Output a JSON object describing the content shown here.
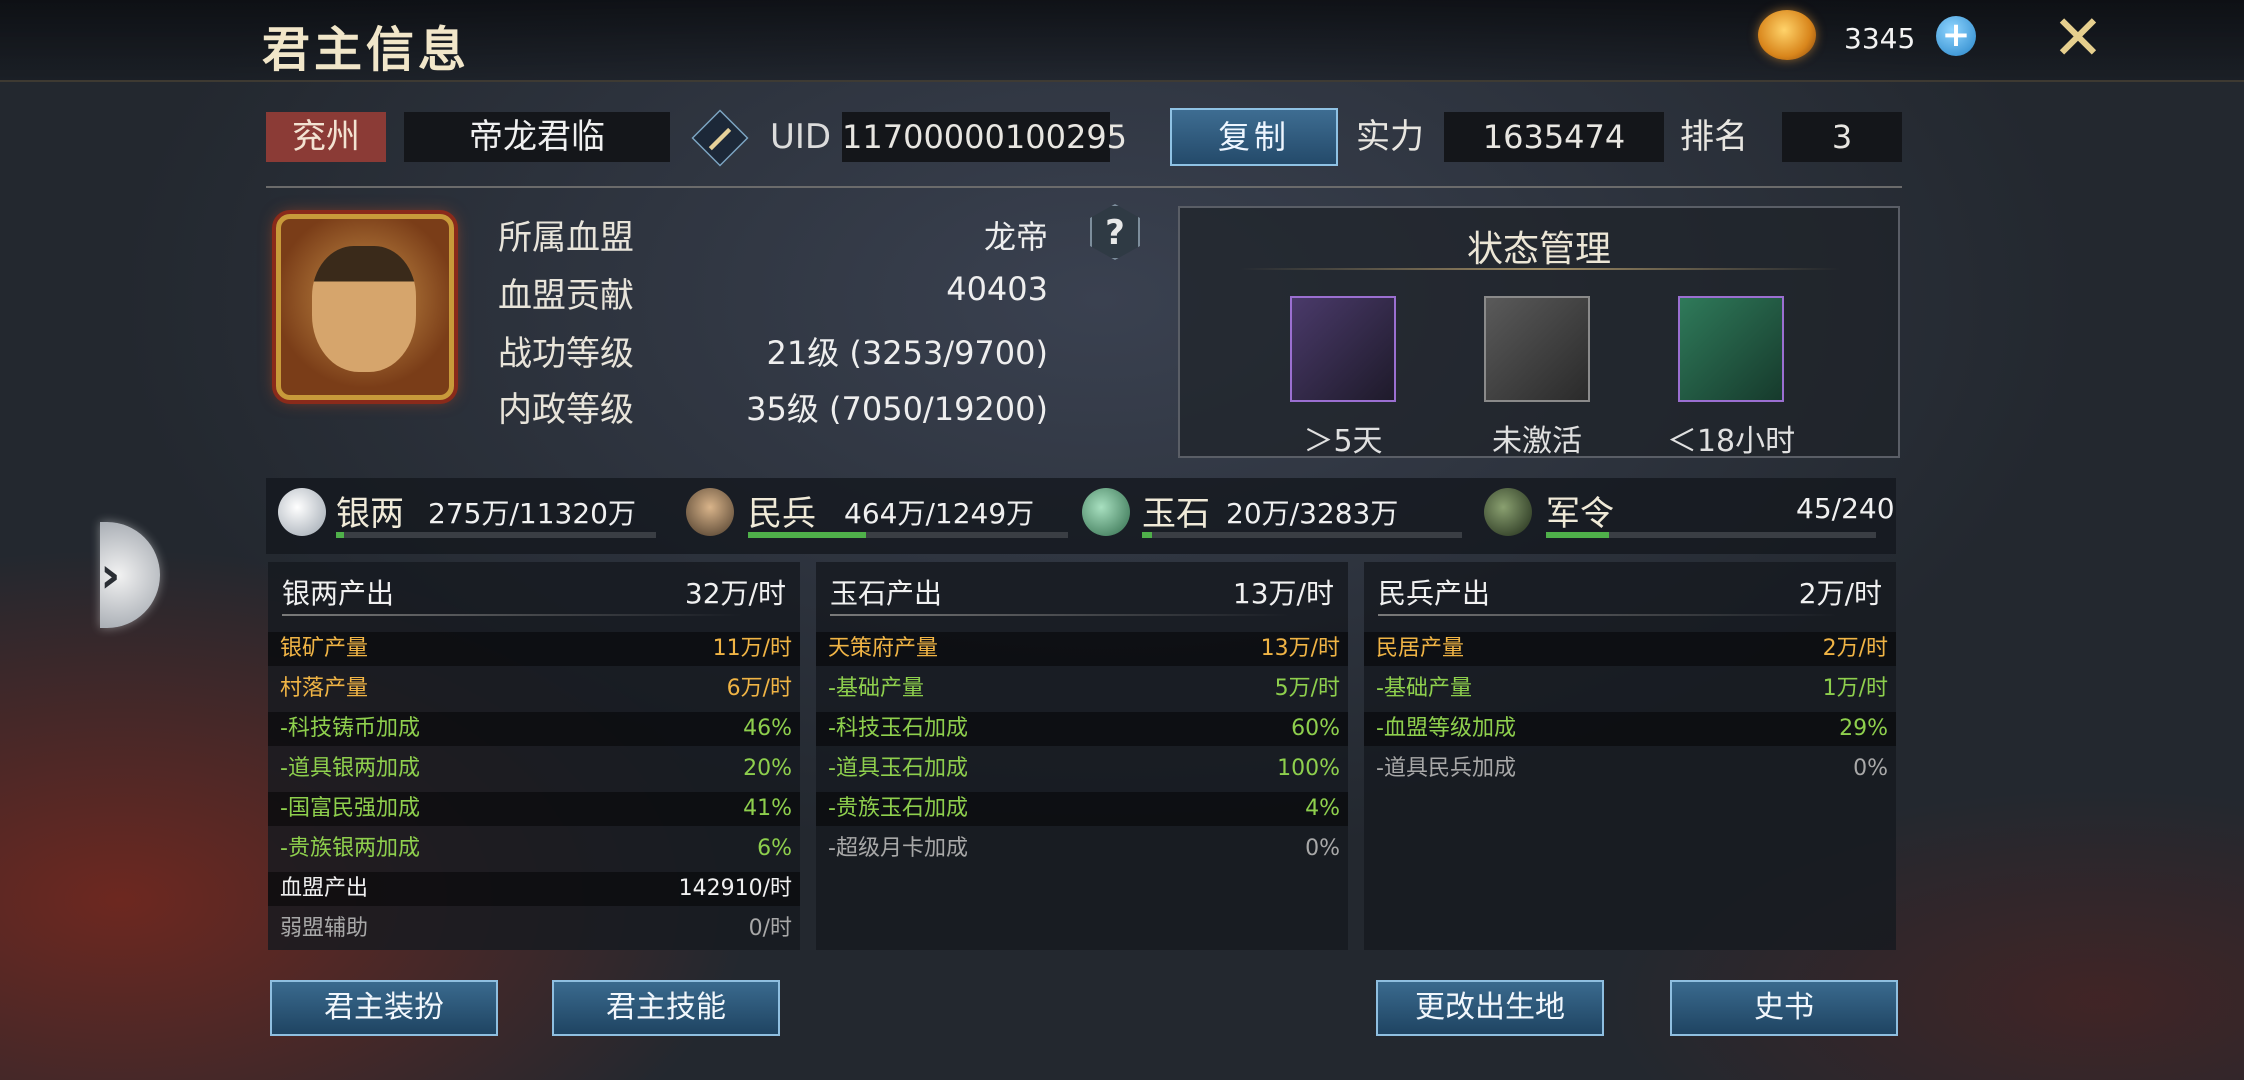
{
  "header": {
    "title": "君主信息",
    "gold": "3345",
    "plus": "+",
    "close": "✕"
  },
  "profile": {
    "province": "兖州",
    "name": "帝龙君临",
    "uid_label": "UID",
    "uid": "11700000100295",
    "copy_label": "复制",
    "power_label": "实力",
    "power": "1635474",
    "rank_label": "排名",
    "rank": "3"
  },
  "details": [
    {
      "label": "所属血盟",
      "value": "龙帝"
    },
    {
      "label": "血盟贡献",
      "value": "40403"
    },
    {
      "label": "战功等级",
      "value": "21级 (3253/9700)"
    },
    {
      "label": "内政等级",
      "value": "35级 (7050/19200)"
    }
  ],
  "help": "?",
  "status": {
    "title": "状态管理",
    "items": [
      {
        "icon": "pickaxe-icon",
        "text": "＞5天",
        "border": "#9b6fd1"
      },
      {
        "icon": "seal-scroll-icon",
        "text": "未激活",
        "border": "#8a8a8a"
      },
      {
        "icon": "jade-pickaxe-icon",
        "text": "＜18小时",
        "border": "#9b6fd1"
      }
    ]
  },
  "resources": [
    {
      "name": "银两",
      "value": "275万/11320万",
      "fill": 0.024
    },
    {
      "name": "民兵",
      "value": "464万/1249万",
      "fill": 0.37
    },
    {
      "name": "玉石",
      "value": "20万/3283万",
      "fill": 0.03
    },
    {
      "name": "军令",
      "value": "45/240",
      "fill": 0.19
    }
  ],
  "panels": [
    {
      "title": "银两产出",
      "total": "32万/时",
      "rows": [
        {
          "label": "银矿产量",
          "value": "11万/时",
          "color": "gold"
        },
        {
          "label": "村落产量",
          "value": "6万/时",
          "color": "gold"
        },
        {
          "label": "-科技铸币加成",
          "value": "46%",
          "color": "green"
        },
        {
          "label": "-道具银两加成",
          "value": "20%",
          "color": "green"
        },
        {
          "label": "-国富民强加成",
          "value": "41%",
          "color": "green"
        },
        {
          "label": "-贵族银两加成",
          "value": "6%",
          "color": "green"
        },
        {
          "label": "血盟产出",
          "value": "142910/时",
          "color": "white"
        },
        {
          "label": "弱盟辅助",
          "value": "0/时",
          "color": "grey"
        }
      ]
    },
    {
      "title": "玉石产出",
      "total": "13万/时",
      "rows": [
        {
          "label": "天策府产量",
          "value": "13万/时",
          "color": "gold"
        },
        {
          "label": "-基础产量",
          "value": "5万/时",
          "color": "green"
        },
        {
          "label": "-科技玉石加成",
          "value": "60%",
          "color": "green"
        },
        {
          "label": "-道具玉石加成",
          "value": "100%",
          "color": "green"
        },
        {
          "label": "-贵族玉石加成",
          "value": "4%",
          "color": "green"
        },
        {
          "label": "-超级月卡加成",
          "value": "0%",
          "color": "grey"
        }
      ]
    },
    {
      "title": "民兵产出",
      "total": "2万/时",
      "rows": [
        {
          "label": "民居产量",
          "value": "2万/时",
          "color": "gold"
        },
        {
          "label": "-基础产量",
          "value": "1万/时",
          "color": "green"
        },
        {
          "label": "-血盟等级加成",
          "value": "29%",
          "color": "green"
        },
        {
          "label": "-道具民兵加成",
          "value": "0%",
          "color": "grey"
        }
      ]
    }
  ],
  "buttons": {
    "outfit": "君主装扮",
    "skills": "君主技能",
    "birthplace": "更改出生地",
    "history": "史书"
  },
  "side_tab": "›"
}
